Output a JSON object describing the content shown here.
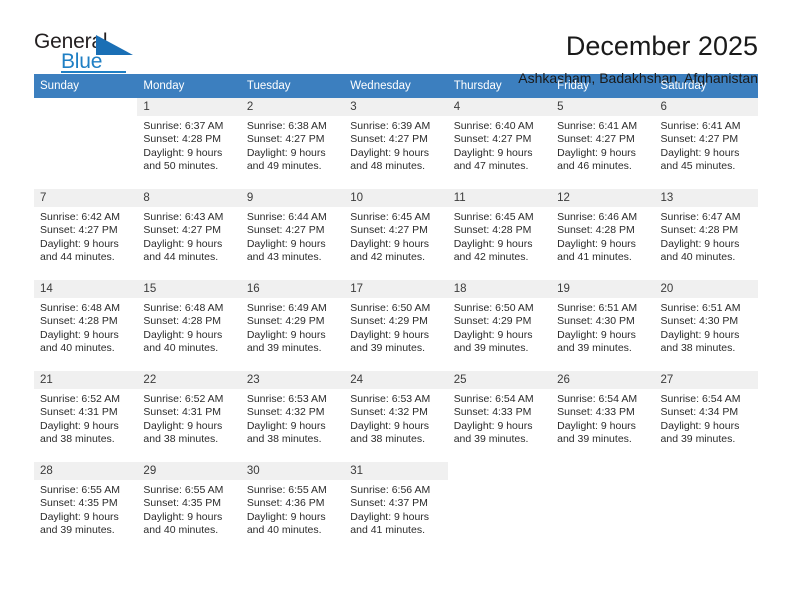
{
  "brand": {
    "name_part1": "General",
    "name_part2": "Blue",
    "accent_color": "#1f7fc4",
    "triangle_color": "#1a6fb5"
  },
  "header": {
    "title": "December 2025",
    "subtitle": "Ashkasham, Badakhshan, Afghanistan",
    "header_bg_color": "#3c7fbf",
    "daynum_bg_color": "#f0f0f0"
  },
  "weekdays": [
    "Sunday",
    "Monday",
    "Tuesday",
    "Wednesday",
    "Thursday",
    "Friday",
    "Saturday"
  ],
  "weeks": [
    [
      {
        "day": "",
        "sunrise": "",
        "sunset": "",
        "daylight1": "",
        "daylight2": "",
        "blank": true
      },
      {
        "day": "1",
        "sunrise": "Sunrise: 6:37 AM",
        "sunset": "Sunset: 4:28 PM",
        "daylight1": "Daylight: 9 hours",
        "daylight2": "and 50 minutes."
      },
      {
        "day": "2",
        "sunrise": "Sunrise: 6:38 AM",
        "sunset": "Sunset: 4:27 PM",
        "daylight1": "Daylight: 9 hours",
        "daylight2": "and 49 minutes."
      },
      {
        "day": "3",
        "sunrise": "Sunrise: 6:39 AM",
        "sunset": "Sunset: 4:27 PM",
        "daylight1": "Daylight: 9 hours",
        "daylight2": "and 48 minutes."
      },
      {
        "day": "4",
        "sunrise": "Sunrise: 6:40 AM",
        "sunset": "Sunset: 4:27 PM",
        "daylight1": "Daylight: 9 hours",
        "daylight2": "and 47 minutes."
      },
      {
        "day": "5",
        "sunrise": "Sunrise: 6:41 AM",
        "sunset": "Sunset: 4:27 PM",
        "daylight1": "Daylight: 9 hours",
        "daylight2": "and 46 minutes."
      },
      {
        "day": "6",
        "sunrise": "Sunrise: 6:41 AM",
        "sunset": "Sunset: 4:27 PM",
        "daylight1": "Daylight: 9 hours",
        "daylight2": "and 45 minutes."
      }
    ],
    [
      {
        "day": "7",
        "sunrise": "Sunrise: 6:42 AM",
        "sunset": "Sunset: 4:27 PM",
        "daylight1": "Daylight: 9 hours",
        "daylight2": "and 44 minutes."
      },
      {
        "day": "8",
        "sunrise": "Sunrise: 6:43 AM",
        "sunset": "Sunset: 4:27 PM",
        "daylight1": "Daylight: 9 hours",
        "daylight2": "and 44 minutes."
      },
      {
        "day": "9",
        "sunrise": "Sunrise: 6:44 AM",
        "sunset": "Sunset: 4:27 PM",
        "daylight1": "Daylight: 9 hours",
        "daylight2": "and 43 minutes."
      },
      {
        "day": "10",
        "sunrise": "Sunrise: 6:45 AM",
        "sunset": "Sunset: 4:27 PM",
        "daylight1": "Daylight: 9 hours",
        "daylight2": "and 42 minutes."
      },
      {
        "day": "11",
        "sunrise": "Sunrise: 6:45 AM",
        "sunset": "Sunset: 4:28 PM",
        "daylight1": "Daylight: 9 hours",
        "daylight2": "and 42 minutes."
      },
      {
        "day": "12",
        "sunrise": "Sunrise: 6:46 AM",
        "sunset": "Sunset: 4:28 PM",
        "daylight1": "Daylight: 9 hours",
        "daylight2": "and 41 minutes."
      },
      {
        "day": "13",
        "sunrise": "Sunrise: 6:47 AM",
        "sunset": "Sunset: 4:28 PM",
        "daylight1": "Daylight: 9 hours",
        "daylight2": "and 40 minutes."
      }
    ],
    [
      {
        "day": "14",
        "sunrise": "Sunrise: 6:48 AM",
        "sunset": "Sunset: 4:28 PM",
        "daylight1": "Daylight: 9 hours",
        "daylight2": "and 40 minutes."
      },
      {
        "day": "15",
        "sunrise": "Sunrise: 6:48 AM",
        "sunset": "Sunset: 4:28 PM",
        "daylight1": "Daylight: 9 hours",
        "daylight2": "and 40 minutes."
      },
      {
        "day": "16",
        "sunrise": "Sunrise: 6:49 AM",
        "sunset": "Sunset: 4:29 PM",
        "daylight1": "Daylight: 9 hours",
        "daylight2": "and 39 minutes."
      },
      {
        "day": "17",
        "sunrise": "Sunrise: 6:50 AM",
        "sunset": "Sunset: 4:29 PM",
        "daylight1": "Daylight: 9 hours",
        "daylight2": "and 39 minutes."
      },
      {
        "day": "18",
        "sunrise": "Sunrise: 6:50 AM",
        "sunset": "Sunset: 4:29 PM",
        "daylight1": "Daylight: 9 hours",
        "daylight2": "and 39 minutes."
      },
      {
        "day": "19",
        "sunrise": "Sunrise: 6:51 AM",
        "sunset": "Sunset: 4:30 PM",
        "daylight1": "Daylight: 9 hours",
        "daylight2": "and 39 minutes."
      },
      {
        "day": "20",
        "sunrise": "Sunrise: 6:51 AM",
        "sunset": "Sunset: 4:30 PM",
        "daylight1": "Daylight: 9 hours",
        "daylight2": "and 38 minutes."
      }
    ],
    [
      {
        "day": "21",
        "sunrise": "Sunrise: 6:52 AM",
        "sunset": "Sunset: 4:31 PM",
        "daylight1": "Daylight: 9 hours",
        "daylight2": "and 38 minutes."
      },
      {
        "day": "22",
        "sunrise": "Sunrise: 6:52 AM",
        "sunset": "Sunset: 4:31 PM",
        "daylight1": "Daylight: 9 hours",
        "daylight2": "and 38 minutes."
      },
      {
        "day": "23",
        "sunrise": "Sunrise: 6:53 AM",
        "sunset": "Sunset: 4:32 PM",
        "daylight1": "Daylight: 9 hours",
        "daylight2": "and 38 minutes."
      },
      {
        "day": "24",
        "sunrise": "Sunrise: 6:53 AM",
        "sunset": "Sunset: 4:32 PM",
        "daylight1": "Daylight: 9 hours",
        "daylight2": "and 38 minutes."
      },
      {
        "day": "25",
        "sunrise": "Sunrise: 6:54 AM",
        "sunset": "Sunset: 4:33 PM",
        "daylight1": "Daylight: 9 hours",
        "daylight2": "and 39 minutes."
      },
      {
        "day": "26",
        "sunrise": "Sunrise: 6:54 AM",
        "sunset": "Sunset: 4:33 PM",
        "daylight1": "Daylight: 9 hours",
        "daylight2": "and 39 minutes."
      },
      {
        "day": "27",
        "sunrise": "Sunrise: 6:54 AM",
        "sunset": "Sunset: 4:34 PM",
        "daylight1": "Daylight: 9 hours",
        "daylight2": "and 39 minutes."
      }
    ],
    [
      {
        "day": "28",
        "sunrise": "Sunrise: 6:55 AM",
        "sunset": "Sunset: 4:35 PM",
        "daylight1": "Daylight: 9 hours",
        "daylight2": "and 39 minutes."
      },
      {
        "day": "29",
        "sunrise": "Sunrise: 6:55 AM",
        "sunset": "Sunset: 4:35 PM",
        "daylight1": "Daylight: 9 hours",
        "daylight2": "and 40 minutes."
      },
      {
        "day": "30",
        "sunrise": "Sunrise: 6:55 AM",
        "sunset": "Sunset: 4:36 PM",
        "daylight1": "Daylight: 9 hours",
        "daylight2": "and 40 minutes."
      },
      {
        "day": "31",
        "sunrise": "Sunrise: 6:56 AM",
        "sunset": "Sunset: 4:37 PM",
        "daylight1": "Daylight: 9 hours",
        "daylight2": "and 41 minutes."
      },
      {
        "day": "",
        "sunrise": "",
        "sunset": "",
        "daylight1": "",
        "daylight2": "",
        "blank": true
      },
      {
        "day": "",
        "sunrise": "",
        "sunset": "",
        "daylight1": "",
        "daylight2": "",
        "blank": true
      },
      {
        "day": "",
        "sunrise": "",
        "sunset": "",
        "daylight1": "",
        "daylight2": "",
        "blank": true
      }
    ]
  ]
}
